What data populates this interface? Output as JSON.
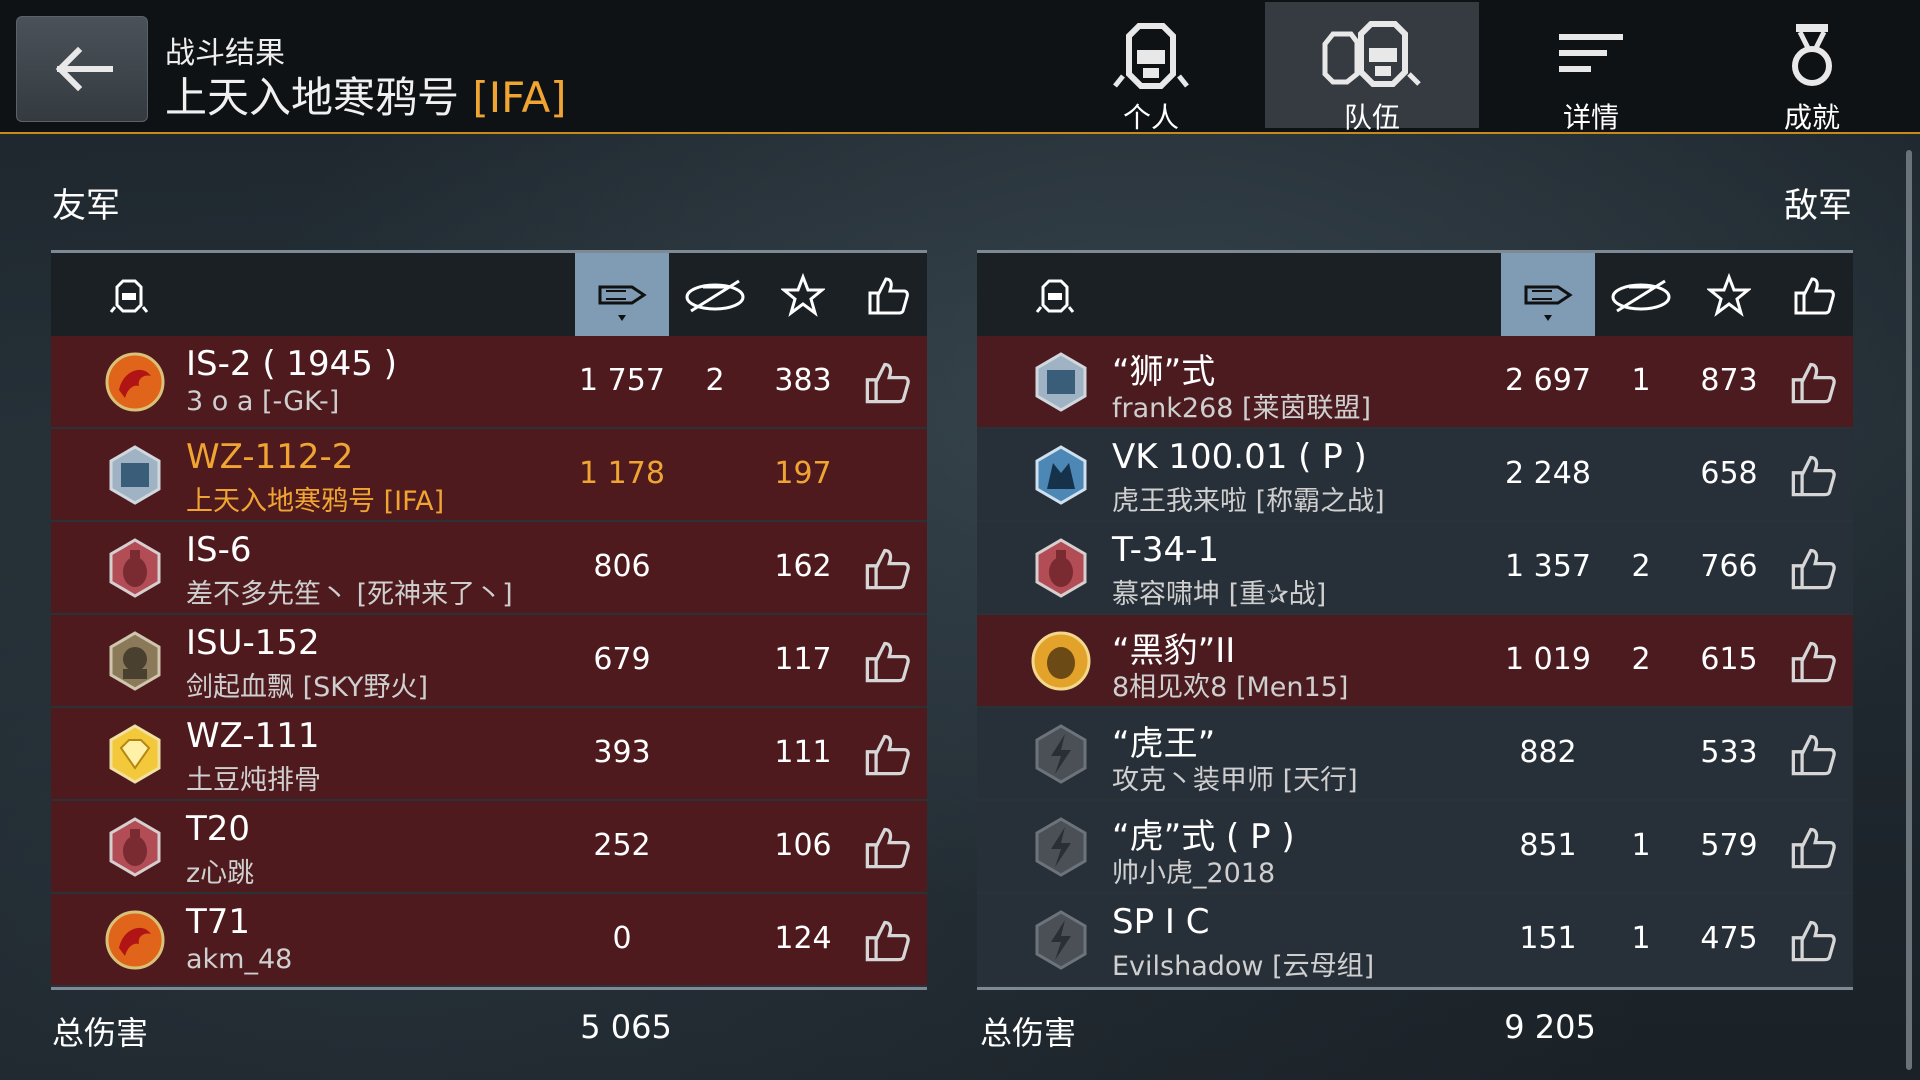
{
  "header": {
    "subtitle": "战斗结果",
    "title_name": "上天入地寒鸦号",
    "title_clan": "[IFA]"
  },
  "tabs": [
    {
      "label": "个人",
      "icon": "helmet-single-icon",
      "active": false
    },
    {
      "label": "队伍",
      "icon": "helmet-team-icon",
      "active": true
    },
    {
      "label": "详情",
      "icon": "details-lines-icon",
      "active": false
    },
    {
      "label": "成就",
      "icon": "medal-icon",
      "active": false
    }
  ],
  "allies": {
    "title": "友军",
    "rows": [
      {
        "tank": "IS-2 ( 1945 )",
        "player": "3 o a [-GK-]",
        "damage": "1 757",
        "kills": "2",
        "score": "383",
        "emblem": "red-dragon",
        "style": "red",
        "me": false,
        "like": true
      },
      {
        "tank": "WZ-112-2",
        "player": "上天入地寒鸦号 [IFA]",
        "damage": "1 178",
        "kills": "",
        "score": "197",
        "emblem": "blue-tank-emblem",
        "style": "red",
        "me": true,
        "like": false
      },
      {
        "tank": "IS-6",
        "player": "差不多先笙丶 [死神来了丶]",
        "damage": "806",
        "kills": "",
        "score": "162",
        "emblem": "grenade-emblem",
        "style": "red",
        "me": false,
        "like": true
      },
      {
        "tank": "ISU-152",
        "player": "剑起血飘 [SKY野火]",
        "damage": "679",
        "kills": "",
        "score": "117",
        "emblem": "soldier-emblem",
        "style": "red",
        "me": false,
        "like": true
      },
      {
        "tank": "WZ-111",
        "player": "土豆炖排骨",
        "damage": "393",
        "kills": "",
        "score": "111",
        "emblem": "diamond-emblem",
        "style": "red",
        "me": false,
        "like": true
      },
      {
        "tank": "T20",
        "player": "z心跳",
        "damage": "252",
        "kills": "",
        "score": "106",
        "emblem": "grenade-emblem",
        "style": "red",
        "me": false,
        "like": true
      },
      {
        "tank": "T71",
        "player": "akm_48",
        "damage": "0",
        "kills": "",
        "score": "124",
        "emblem": "red-dragon",
        "style": "red",
        "me": false,
        "like": true
      }
    ],
    "total_label": "总伤害",
    "total_value": "5 065"
  },
  "enemies": {
    "title": "敌军",
    "rows": [
      {
        "tank": "“狮”式",
        "player": "frank268 [莱茵联盟]",
        "damage": "2 697",
        "kills": "1",
        "score": "873",
        "emblem": "blue-tank-emblem",
        "style": "enemy-red",
        "me": false,
        "like": true
      },
      {
        "tank": "VK 100.01 ( P )",
        "player": "虎王我来啦 [称霸之战]",
        "damage": "2 248",
        "kills": "",
        "score": "658",
        "emblem": "wolf-emblem",
        "style": "enemy-dark",
        "me": false,
        "like": true
      },
      {
        "tank": "T-34-1",
        "player": "慕容啸坤 [重✰战]",
        "damage": "1 357",
        "kills": "2",
        "score": "766",
        "emblem": "grenade-emblem",
        "style": "enemy-dark",
        "me": false,
        "like": true
      },
      {
        "tank": "“黑豹”II",
        "player": "8相见欢8 [Men15]",
        "damage": "1 019",
        "kills": "2",
        "score": "615",
        "emblem": "tiger-emblem",
        "style": "enemy-red",
        "me": false,
        "like": true
      },
      {
        "tank": "“虎王”",
        "player": "攻克丶装甲师 [天行]",
        "damage": "882",
        "kills": "",
        "score": "533",
        "emblem": "grey-lightning-emblem",
        "style": "enemy-dark",
        "me": false,
        "like": true
      },
      {
        "tank": "“虎”式 ( P )",
        "player": "帅小虎_2018",
        "damage": "851",
        "kills": "1",
        "score": "579",
        "emblem": "grey-lightning-emblem",
        "style": "enemy-dark",
        "me": false,
        "like": true
      },
      {
        "tank": "SP I C",
        "player": "Evilshadow [云母组]",
        "damage": "151",
        "kills": "1",
        "score": "475",
        "emblem": "grey-lightning-emblem",
        "style": "enemy-dark",
        "me": false,
        "like": true
      }
    ],
    "total_label": "总伤害",
    "total_value": "9 205"
  },
  "columns": {
    "player_icon": "helmet-icon",
    "damage_icon": "damage-shell-icon",
    "kills_icon": "destroyed-tank-icon",
    "score_icon": "star-icon",
    "like_icon": "thumbs-up-icon",
    "sorted_by": "damage"
  },
  "colors": {
    "accent": "#f0a533",
    "sorted_header": "#7f9cb4",
    "ally_row": "#4e1a1e",
    "enemy_row": "#273039",
    "topbar_line": "#c98a1b"
  }
}
